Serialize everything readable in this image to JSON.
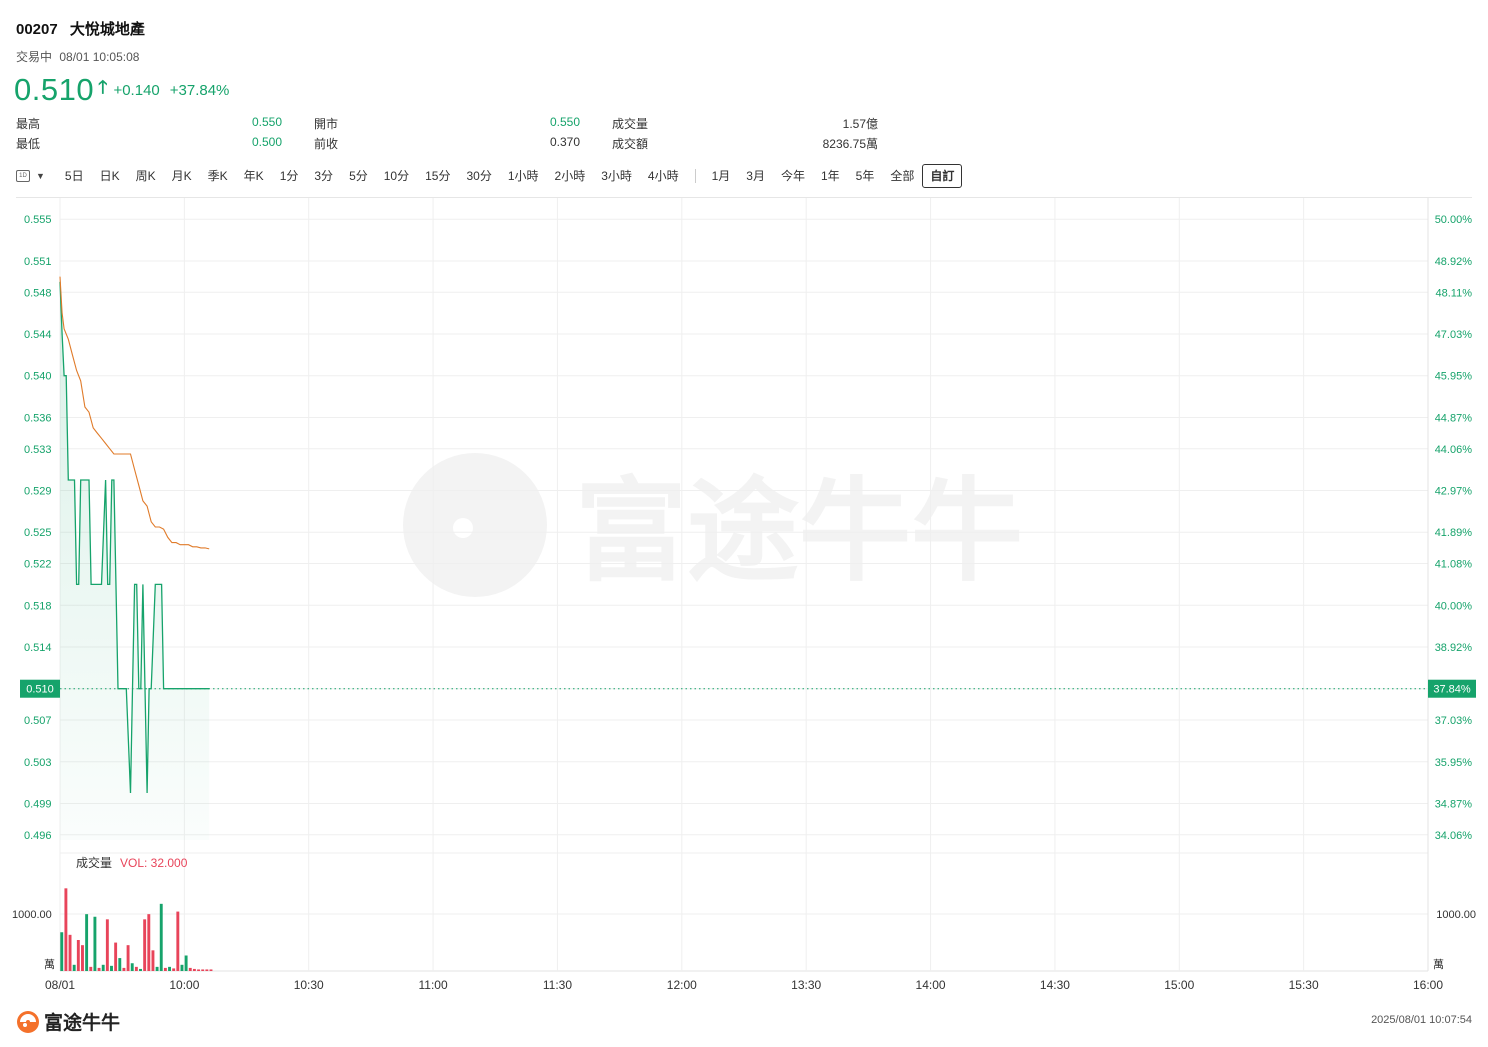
{
  "header": {
    "code": "00207",
    "name": "大悅城地產",
    "status": "交易中",
    "datetime": "08/01 10:05:08",
    "price": "0.510",
    "change": "+0.140",
    "change_pct": "+37.84%"
  },
  "stats": {
    "high_label": "最高",
    "high": "0.550",
    "low_label": "最低",
    "low": "0.500",
    "open_label": "開市",
    "open": "0.550",
    "prev_label": "前收",
    "prev": "0.370",
    "vol_label": "成交量",
    "vol": "1.57億",
    "amt_label": "成交額",
    "amt": "8236.75萬"
  },
  "tabs": [
    "5日",
    "日K",
    "周K",
    "月K",
    "季K",
    "年K",
    "1分",
    "3分",
    "5分",
    "10分",
    "15分",
    "30分",
    "1小時",
    "2小時",
    "3小時",
    "4小時",
    "1月",
    "3月",
    "今年",
    "1年",
    "5年",
    "全部",
    "自訂"
  ],
  "period_icon_label": "1D",
  "active_tab": "自訂",
  "colors": {
    "up": "#16a36b",
    "down": "#e8445a",
    "avg_line": "#e07b2a",
    "grid": "#efefef"
  },
  "chart_data": {
    "type": "line",
    "price_ticks": [
      "0.555",
      "0.551",
      "0.548",
      "0.544",
      "0.540",
      "0.536",
      "0.533",
      "0.529",
      "0.525",
      "0.522",
      "0.518",
      "0.514",
      "0.510",
      "0.507",
      "0.503",
      "0.499",
      "0.496"
    ],
    "pct_ticks": [
      "50.00%",
      "48.92%",
      "48.11%",
      "47.03%",
      "45.95%",
      "44.87%",
      "44.06%",
      "42.97%",
      "41.89%",
      "41.08%",
      "40.00%",
      "38.92%",
      "37.84%",
      "37.03%",
      "35.95%",
      "34.87%",
      "34.06%"
    ],
    "ylim": [
      0.4955,
      0.5555
    ],
    "x_labels": [
      "08/01",
      "10:00",
      "10:30",
      "11:00",
      "11:30",
      "12:00",
      "13:30",
      "14:00",
      "14:30",
      "15:00",
      "15:30",
      "16:00"
    ],
    "current_price": "0.510",
    "current_pct": "37.84%",
    "price_minutes": [
      0,
      0.5,
      1,
      1.5,
      2,
      2.5,
      3,
      3.5,
      4,
      4.5,
      5,
      6,
      6.5,
      7,
      7.5,
      8,
      9,
      10,
      11,
      11.5,
      12,
      12.5,
      13,
      14,
      15,
      16,
      17,
      17.5,
      18,
      18.5,
      19,
      19.5,
      20,
      20.5,
      21,
      21.5,
      22,
      23,
      24,
      24.5,
      25,
      26,
      27,
      28,
      29,
      30,
      31,
      31.5,
      32,
      33,
      34,
      35,
      36
    ],
    "price": [
      0.549,
      0.544,
      0.54,
      0.54,
      0.53,
      0.53,
      0.53,
      0.53,
      0.52,
      0.52,
      0.53,
      0.53,
      0.53,
      0.53,
      0.52,
      0.52,
      0.52,
      0.52,
      0.53,
      0.52,
      0.52,
      0.53,
      0.53,
      0.51,
      0.51,
      0.51,
      0.5,
      0.51,
      0.52,
      0.52,
      0.51,
      0.51,
      0.52,
      0.51,
      0.5,
      0.51,
      0.51,
      0.52,
      0.52,
      0.52,
      0.51,
      0.51,
      0.51,
      0.51,
      0.51,
      0.51,
      0.51,
      0.51,
      0.51,
      0.51,
      0.51,
      0.51,
      0.51
    ],
    "avg_minutes": [
      0,
      0.5,
      1,
      2,
      3,
      4,
      5,
      6,
      7,
      8,
      9,
      10,
      11,
      12,
      13,
      14,
      15,
      16,
      17,
      18,
      19,
      20,
      21,
      22,
      23,
      24,
      25,
      26,
      27,
      28,
      29,
      30,
      31,
      32,
      33,
      34,
      35,
      36
    ],
    "avg": [
      0.5495,
      0.546,
      0.5445,
      0.5435,
      0.542,
      0.5405,
      0.5395,
      0.537,
      0.5365,
      0.535,
      0.5345,
      0.534,
      0.5335,
      0.533,
      0.5325,
      0.5325,
      0.5325,
      0.5325,
      0.5325,
      0.531,
      0.5295,
      0.528,
      0.5275,
      0.526,
      0.5255,
      0.5255,
      0.5253,
      0.5245,
      0.524,
      0.524,
      0.5238,
      0.5238,
      0.5238,
      0.5236,
      0.5236,
      0.5235,
      0.5235,
      0.5234
    ],
    "volume_label": "成交量",
    "volume_value_label": "VOL: 32.000",
    "volume_tick": "1000.00",
    "volume_unit": "萬",
    "volume_max": 1800,
    "volume": [
      {
        "m": 0,
        "v": 750,
        "c": "up"
      },
      {
        "m": 1,
        "v": 1600,
        "c": "down"
      },
      {
        "m": 2,
        "v": 700,
        "c": "down"
      },
      {
        "m": 3,
        "v": 120,
        "c": "up"
      },
      {
        "m": 4,
        "v": 600,
        "c": "down"
      },
      {
        "m": 5,
        "v": 500,
        "c": "down"
      },
      {
        "m": 6,
        "v": 1100,
        "c": "up"
      },
      {
        "m": 7,
        "v": 80,
        "c": "down"
      },
      {
        "m": 8,
        "v": 1050,
        "c": "up"
      },
      {
        "m": 9,
        "v": 60,
        "c": "down"
      },
      {
        "m": 10,
        "v": 120,
        "c": "up"
      },
      {
        "m": 11,
        "v": 1000,
        "c": "down"
      },
      {
        "m": 12,
        "v": 100,
        "c": "up"
      },
      {
        "m": 13,
        "v": 550,
        "c": "down"
      },
      {
        "m": 14,
        "v": 250,
        "c": "up"
      },
      {
        "m": 15,
        "v": 60,
        "c": "down"
      },
      {
        "m": 16,
        "v": 500,
        "c": "down"
      },
      {
        "m": 17,
        "v": 150,
        "c": "up"
      },
      {
        "m": 18,
        "v": 80,
        "c": "down"
      },
      {
        "m": 19,
        "v": 40,
        "c": "up"
      },
      {
        "m": 20,
        "v": 1000,
        "c": "down"
      },
      {
        "m": 21,
        "v": 1100,
        "c": "down"
      },
      {
        "m": 22,
        "v": 400,
        "c": "down"
      },
      {
        "m": 23,
        "v": 80,
        "c": "up"
      },
      {
        "m": 24,
        "v": 1300,
        "c": "up"
      },
      {
        "m": 25,
        "v": 60,
        "c": "down"
      },
      {
        "m": 26,
        "v": 80,
        "c": "up"
      },
      {
        "m": 27,
        "v": 50,
        "c": "down"
      },
      {
        "m": 28,
        "v": 1150,
        "c": "down"
      },
      {
        "m": 29,
        "v": 120,
        "c": "up"
      },
      {
        "m": 30,
        "v": 300,
        "c": "up"
      },
      {
        "m": 31,
        "v": 60,
        "c": "down"
      },
      {
        "m": 32,
        "v": 40,
        "c": "down"
      },
      {
        "m": 33,
        "v": 30,
        "c": "down"
      },
      {
        "m": 34,
        "v": 30,
        "c": "down"
      },
      {
        "m": 35,
        "v": 30,
        "c": "down"
      },
      {
        "m": 36,
        "v": 30,
        "c": "down"
      }
    ]
  },
  "watermark": "富途牛牛",
  "footer": {
    "logo_text": "富途牛牛",
    "timestamp": "2025/08/01 10:07:54"
  }
}
